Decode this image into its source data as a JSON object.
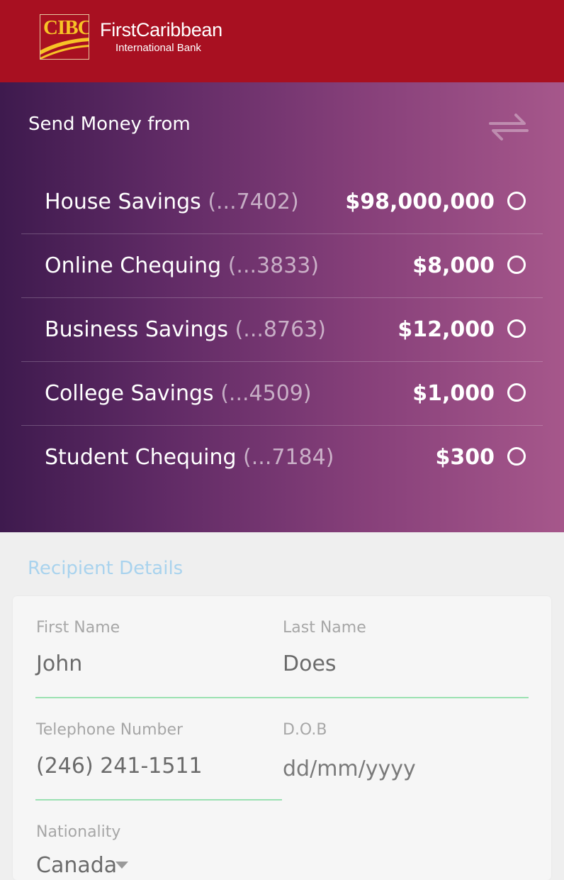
{
  "header": {
    "logo_text": "CIBC",
    "brand_name": "FirstCaribbean",
    "brand_sub": "International Bank"
  },
  "send_money": {
    "title": "Send Money from",
    "swap_icon": "swap-arrows-icon",
    "accounts": [
      {
        "name": "House Savings",
        "number": "(...7402)",
        "balance": "$98,000,000",
        "selected": false
      },
      {
        "name": "Online Chequing",
        "number": "(...3833)",
        "balance": "$8,000",
        "selected": false
      },
      {
        "name": "Business Savings",
        "number": "(...8763)",
        "balance": "$12,000",
        "selected": false
      },
      {
        "name": "College Savings",
        "number": "(...4509)",
        "balance": "$1,000",
        "selected": false
      },
      {
        "name": "Student Chequing",
        "number": "(...7184)",
        "balance": "$300",
        "selected": false
      }
    ]
  },
  "recipient": {
    "title": "Recipient Details",
    "first_name": {
      "label": "First Name",
      "value": "John"
    },
    "last_name": {
      "label": "Last Name",
      "value": "Does"
    },
    "telephone": {
      "label": "Telephone Number",
      "value": "(246) 241-1511"
    },
    "dob": {
      "label": "D.O.B",
      "placeholder": "dd/mm/yyyy"
    },
    "nationality": {
      "label": "Nationality",
      "value": "Canada"
    }
  },
  "colors": {
    "header_red": "#a81021",
    "gradient_start": "#3e1a4e",
    "gradient_end": "#a6578b",
    "accent_green": "#9be1b2",
    "section_title_blue": "#a9d3ee"
  }
}
